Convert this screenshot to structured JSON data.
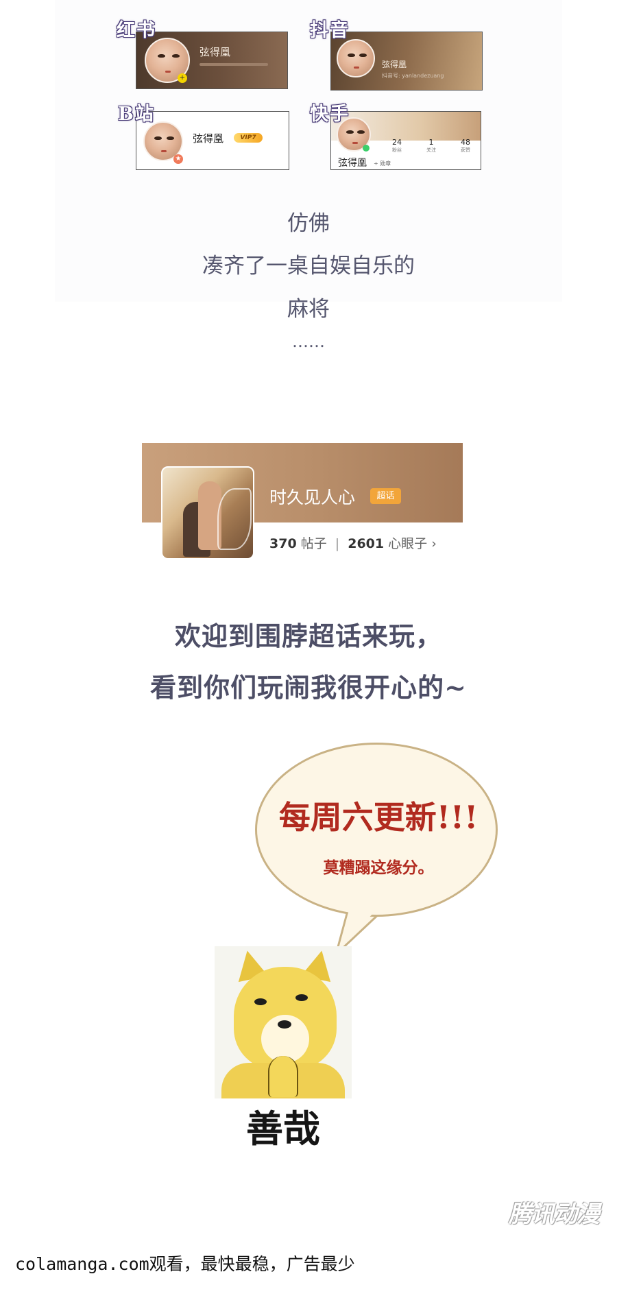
{
  "cards": {
    "app_labels": [
      "红书",
      "抖音",
      "B站",
      "快手"
    ],
    "user_name": "弦得凰",
    "douyin_sub": "抖音号: yanlandezuang",
    "vip_badge": "VIP7",
    "kuaishou_stats": [
      {
        "value": "24",
        "label": "粉丝"
      },
      {
        "value": "1",
        "label": "关注"
      },
      {
        "value": "48",
        "label": "获赞"
      }
    ],
    "kuaishou_medal": "+ 勋章"
  },
  "poem": {
    "line1": "仿佛",
    "line2": "凑齐了一桌自娱自乐的",
    "line3": "麻将",
    "line4": "……"
  },
  "topic": {
    "title": "时久见人心",
    "tag": "超话",
    "posts_count": "370",
    "posts_label": "帖子",
    "fans_count": "2601",
    "fans_label": "心眼子",
    "chevron": "›"
  },
  "welcome": {
    "line1": "欢迎到围脖超话来玩，",
    "line2": "看到你们玩闹我很开心的~"
  },
  "bubble": {
    "line1": "每周六更新!!!",
    "line2": "莫糟蹋这缘分。"
  },
  "doge": {
    "caption": "善哉"
  },
  "watermark": "腾讯动漫",
  "footer": "colamanga.com观看，最快最稳，广告最少"
}
